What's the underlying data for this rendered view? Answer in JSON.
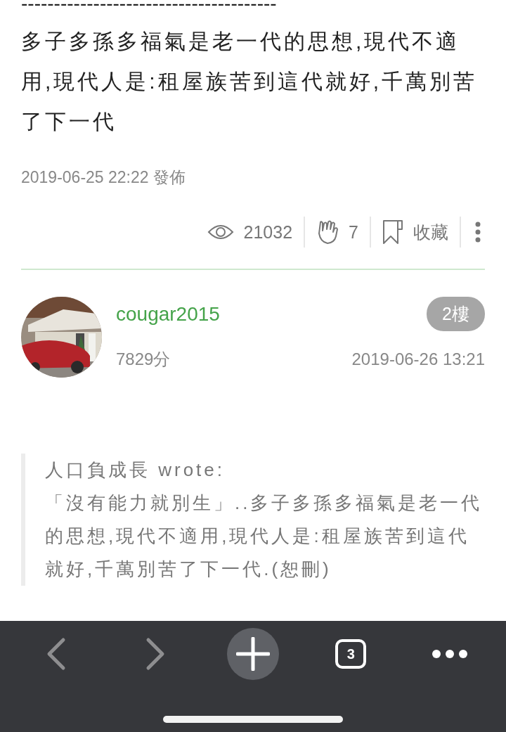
{
  "divider_text": "---------------------------------------",
  "post": {
    "body": "多子多孫多福氣是老一代的思想,現代不適用,現代人是:租屋族苦到這代就好,千萬別苦了下一代",
    "posted": "2019-06-25 22:22 發佈"
  },
  "stats": {
    "views": "21032",
    "claps": "7",
    "bookmark": "收藏"
  },
  "reply": {
    "username": "cougar2015",
    "floor": "2樓",
    "points": "7829分",
    "time": "2019-06-26 13:21",
    "quote": {
      "author": "人口負成長 wrote:",
      "text": "「沒有能力就別生」..多子多孫多福氣是老一代的思想,現代不適用,現代人是:租屋族苦到這代就好,千萬別苦了下一代.(恕刪)"
    }
  },
  "toolbar": {
    "back": {
      "disabled": true
    },
    "forward": {
      "disabled": true
    },
    "tabs_count": "3"
  }
}
